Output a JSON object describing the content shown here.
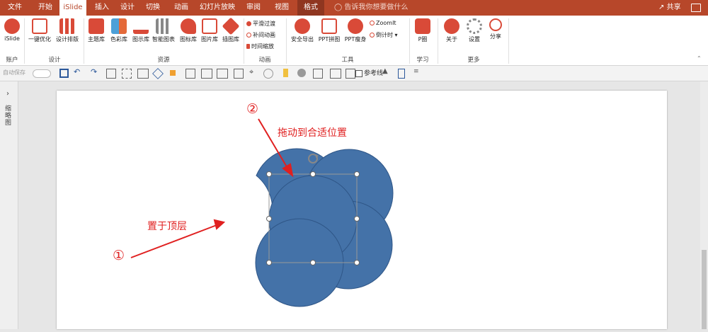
{
  "colors": {
    "accent": "#b7472a",
    "shape_fill": "#4472a8",
    "shape_stroke": "#2f5687",
    "annotation": "#e02020"
  },
  "tabs": [
    {
      "label": "文件",
      "state": "normal"
    },
    {
      "label": "开始",
      "state": "normal"
    },
    {
      "label": "iSlide",
      "state": "active"
    },
    {
      "label": "插入",
      "state": "normal"
    },
    {
      "label": "设计",
      "state": "normal"
    },
    {
      "label": "切换",
      "state": "normal"
    },
    {
      "label": "动画",
      "state": "normal"
    },
    {
      "label": "幻灯片放映",
      "state": "normal"
    },
    {
      "label": "审阅",
      "state": "normal"
    },
    {
      "label": "视图",
      "state": "normal"
    },
    {
      "label": "格式",
      "state": "contextual"
    }
  ],
  "tell_me": "告诉我你想要做什么",
  "share_label": "共享",
  "ribbon": {
    "buttons": [
      {
        "label": "iSlide",
        "icon": "islide-logo-icon",
        "color": "#d94a38"
      },
      {
        "label": "一键优化",
        "icon": "optimize-icon",
        "color": "#d94a38"
      },
      {
        "label": "设计排版",
        "icon": "layout-grid-icon",
        "color": "#d94a38"
      },
      {
        "label": "主题库",
        "icon": "theme-library-icon",
        "color": "#d94a38"
      },
      {
        "label": "色彩库",
        "icon": "color-library-icon",
        "color": "#4ca0d8"
      },
      {
        "label": "图示库",
        "icon": "diagram-library-icon",
        "color": "#d94a38"
      },
      {
        "label": "智能图表",
        "icon": "smart-chart-icon",
        "color": "#888888"
      },
      {
        "label": "图标库",
        "icon": "icon-library-icon",
        "color": "#d94a38"
      },
      {
        "label": "图片库",
        "icon": "picture-library-icon",
        "color": "#d94a38"
      },
      {
        "label": "插图库",
        "icon": "illustration-library-icon",
        "color": "#d94a38"
      },
      {
        "label": "安全导出",
        "icon": "secure-export-icon",
        "color": "#d94a38"
      },
      {
        "label": "PPT拼图",
        "icon": "ppt-collage-icon",
        "color": "#d94a38"
      },
      {
        "label": "PPT瘦身",
        "icon": "ppt-slim-icon",
        "color": "#d94a38"
      },
      {
        "label": "P圈",
        "icon": "p-circle-icon",
        "color": "#d94a38"
      },
      {
        "label": "关于",
        "icon": "about-icon",
        "color": "#d94a38"
      },
      {
        "label": "设置",
        "icon": "settings-gear-icon",
        "color": "#888888"
      },
      {
        "label": "分享",
        "icon": "share-icon",
        "color": "#d94a38"
      }
    ],
    "anim_items": [
      "平滑过渡",
      "补间动画",
      "时间缩放"
    ],
    "tool_items": [
      "ZoomIt",
      "倒计时"
    ],
    "groups": [
      "账户",
      "设计",
      "资源",
      "动画",
      "工具",
      "学习",
      "更多"
    ]
  },
  "qat": {
    "autosave": "自动保存",
    "reference_lines": "参考线"
  },
  "left_pane": {
    "label": "缩略图"
  },
  "slide": {
    "callout_top": "拖动到合适位置",
    "callout_left": "置于顶层",
    "marker_1": "①",
    "marker_2": "②"
  }
}
